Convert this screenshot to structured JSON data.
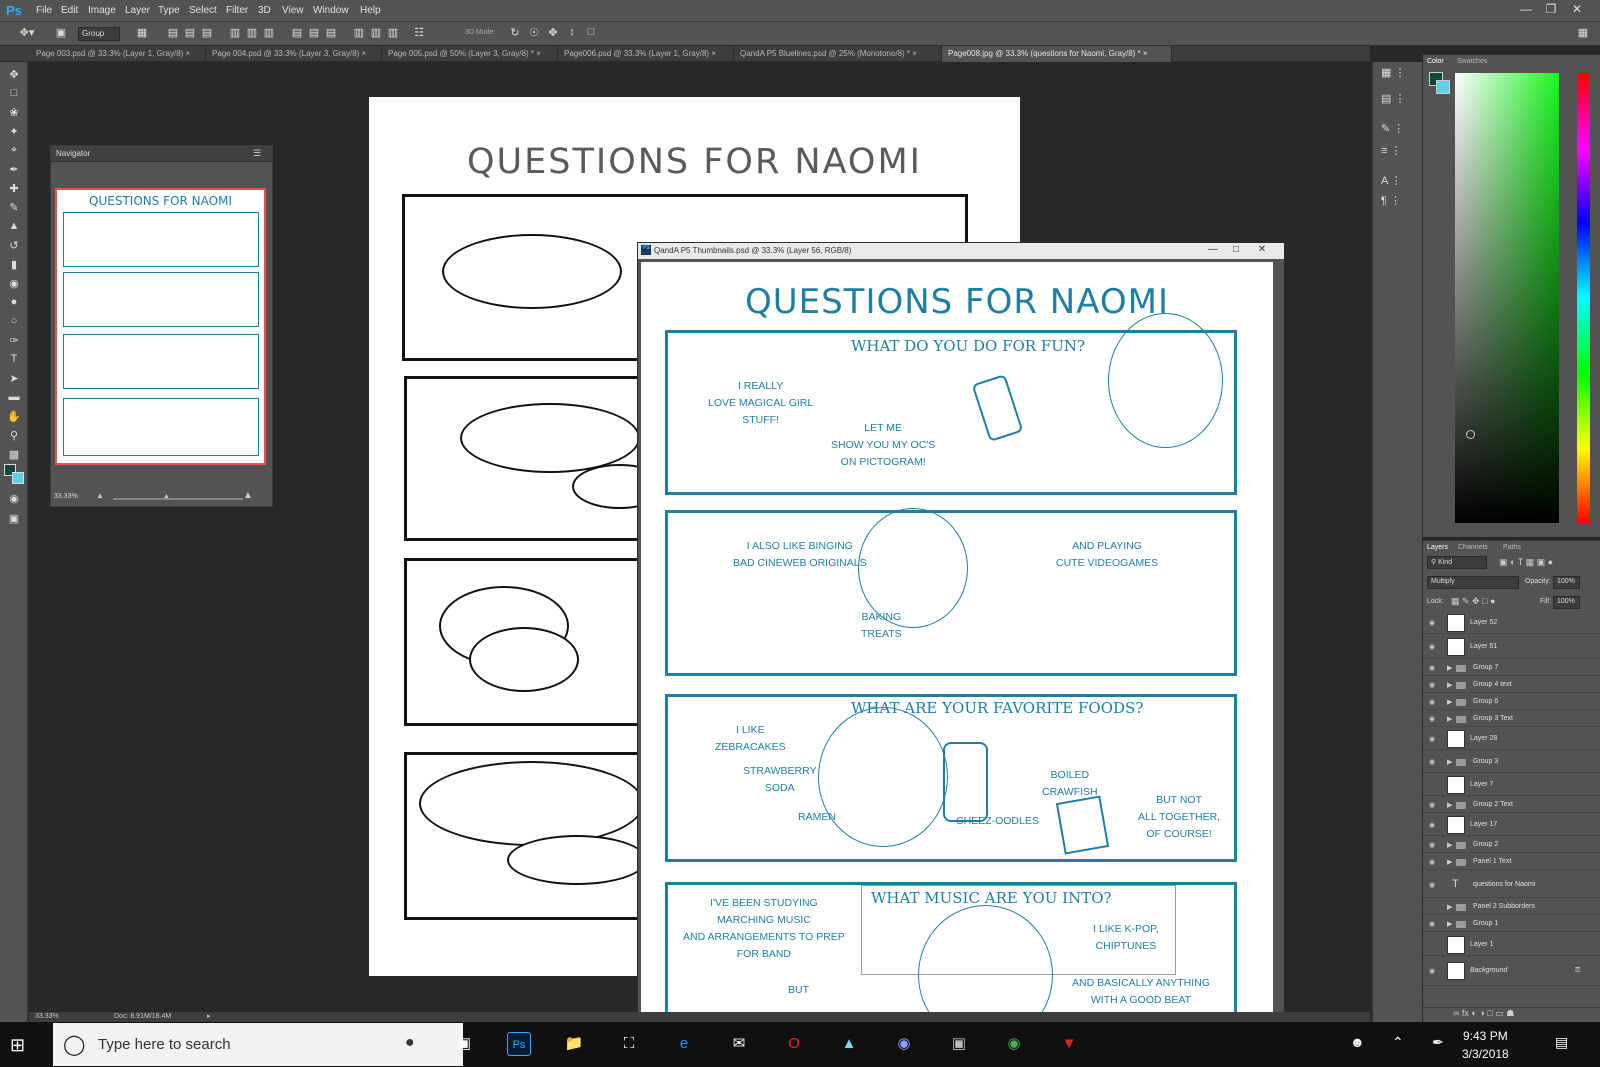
{
  "app": {
    "logo": "Ps"
  },
  "menu": [
    "File",
    "Edit",
    "Image",
    "Layer",
    "Type",
    "Select",
    "Filter",
    "3D",
    "View",
    "Window",
    "Help"
  ],
  "options": {
    "group_select": "Group",
    "mode3d": "3D Mode:"
  },
  "tabs": [
    "Page 003.psd @ 33.3% (Layer 1, Gray/8)",
    "Page 004.psd @ 33.3% (Layer 3, Gray/8)",
    "Page 005.psd @ 50% (Layer 3, Gray/8) *",
    "Page006.psd @ 33.3% (Layer 1, Gray/8)",
    "QandA P5 Bluelines.psd @ 25% (Monotone/8) *",
    "Page008.jpg @ 33.3% (questions for Naomi, Gray/8) *"
  ],
  "navigator": {
    "title": "Navigator",
    "zoom": "33.33%"
  },
  "page_title": "QUESTIONS FOR NAOMI",
  "doc2": {
    "title": "QandA P5 Thumbnails.psd @ 33.3% (Layer 56, RGB/8)",
    "panel1": {
      "heading": "WHAT DO YOU DO FOR FUN?",
      "text_a": "I REALLY\nLOVE MAGICAL GIRL\nSTUFF!",
      "text_b": "LET ME\nSHOW YOU MY OC'S\nON PICTOGRAM!"
    },
    "panel2": {
      "text_a": "I ALSO LIKE BINGING\nBAD CINEWEB ORIGINALS",
      "text_b": "AND PLAYING\nCUTE VIDEOGAMES",
      "text_c": "BAKING\nTREATS"
    },
    "panel3": {
      "heading": "WHAT ARE YOUR FAVORITE FOODS?",
      "text_a": "I LIKE\nZEBRACAKES",
      "text_b": "STRAWBERRY\nSODA",
      "text_c": "RAMEN",
      "text_d": "CHEEZ-OODLES",
      "text_e": "BOILED\nCRAWFISH",
      "text_f": "BUT NOT\nALL TOGETHER,\nOF COURSE!"
    },
    "panel4": {
      "heading": "WHAT MUSIC ARE YOU INTO?",
      "text_a": "I'VE BEEN STUDYING\nMARCHING MUSIC\nAND ARRANGEMENTS TO PREP\nFOR BAND",
      "text_b": "BUT",
      "text_c": "I LIKE K-POP,\nCHIPTUNES",
      "text_d": "AND BASICALLY ANYTHING\nWITH A GOOD BEAT\nOR CLEVER LYRICS"
    }
  },
  "color_panel": {
    "tab1": "Color",
    "tab2": "Swatches",
    "fg": "#0e4b3e",
    "bg": "#5fd0e8"
  },
  "layers_panel": {
    "tabs": [
      "Layers",
      "Channels",
      "Paths"
    ],
    "kind": "Kind",
    "blend": "Multiply",
    "opacity_label": "Opacity:",
    "opacity": "100%",
    "lock_label": "Lock:",
    "fill_label": "Fill:",
    "fill": "100%",
    "layers": [
      {
        "name": "Layer 52",
        "type": "layer",
        "visible": true
      },
      {
        "name": "Layer 51",
        "type": "layer",
        "visible": true
      },
      {
        "name": "Group 7",
        "type": "group",
        "visible": true
      },
      {
        "name": "Group 4 text",
        "type": "group",
        "visible": true
      },
      {
        "name": "Group 6",
        "type": "group",
        "visible": true
      },
      {
        "name": "Group 3 Text",
        "type": "group",
        "visible": true
      },
      {
        "name": "Layer 28",
        "type": "layer",
        "visible": true
      },
      {
        "name": "Group 3",
        "type": "group",
        "visible": true
      },
      {
        "name": "Layer 7",
        "type": "layer",
        "visible": false
      },
      {
        "name": "Group 2 Text",
        "type": "group",
        "visible": true
      },
      {
        "name": "Layer 17",
        "type": "layer",
        "visible": true
      },
      {
        "name": "Group 2",
        "type": "group",
        "visible": true
      },
      {
        "name": "Panel 1 Text",
        "type": "group",
        "visible": true
      },
      {
        "name": "questions for Naomi",
        "type": "text",
        "visible": true
      },
      {
        "name": "Panel 2 Subborders",
        "type": "group",
        "visible": false
      },
      {
        "name": "Group 1",
        "type": "group",
        "visible": true
      },
      {
        "name": "Layer 1",
        "type": "layer",
        "visible": false
      },
      {
        "name": "Background",
        "type": "background",
        "visible": true
      }
    ]
  },
  "status": {
    "zoom": "33.33%",
    "doc": "Doc: 8.91M/18.4M"
  },
  "taskbar": {
    "search_placeholder": "Type here to search",
    "time": "9:43 PM",
    "date": "3/3/2018"
  }
}
